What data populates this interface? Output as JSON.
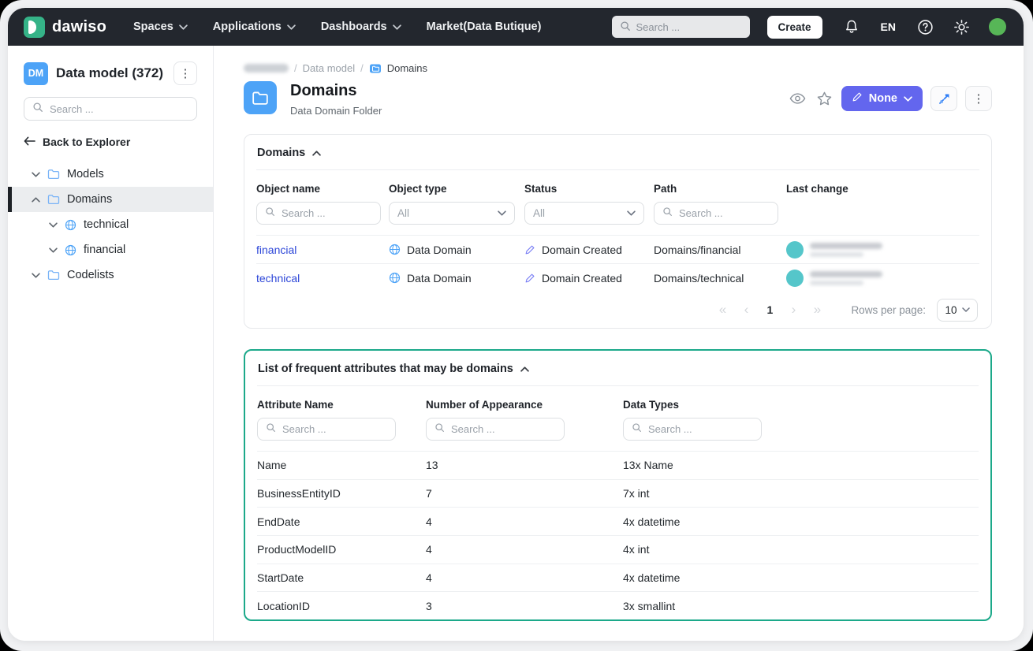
{
  "colors": {
    "navbar_bg": "#23272e",
    "brand_teal": "#35b388",
    "accent_blue": "#4da3f7",
    "link_blue": "#2c46d8",
    "none_button_purple": "#6366ee",
    "status_pencil_purple": "#7b80f5",
    "card2_border_green": "#1ca98a",
    "avatar_teal": "#55c6ca",
    "nav_avatar_green": "#57b657"
  },
  "navbar": {
    "logo": "dawiso",
    "menu": [
      {
        "label": "Spaces"
      },
      {
        "label": "Applications"
      },
      {
        "label": "Dashboards"
      },
      {
        "label": "Market(Data Butique)"
      }
    ],
    "search_placeholder": "Search ...",
    "create_label": "Create",
    "lang": "EN"
  },
  "sidebar": {
    "badge": "DM",
    "title": "Data model (372)",
    "search_placeholder": "Search ...",
    "back_label": "Back to Explorer",
    "tree": [
      {
        "label": "Models"
      },
      {
        "label": "Domains"
      },
      {
        "label": "technical"
      },
      {
        "label": "financial"
      },
      {
        "label": "Codelists"
      }
    ]
  },
  "breadcrumb": {
    "sep": "/",
    "item2": "Data model",
    "item3": "Domains"
  },
  "header": {
    "title": "Domains",
    "subtitle": "Data Domain Folder",
    "none_label": "None"
  },
  "card1": {
    "title": "Domains",
    "columns": [
      "Object name",
      "Object type",
      "Status",
      "Path",
      "Last change"
    ],
    "filters": {
      "object_name_placeholder": "Search ...",
      "object_type_value": "All",
      "status_value": "All",
      "path_placeholder": "Search ..."
    },
    "rows": [
      {
        "name": "financial",
        "type": "Data Domain",
        "status": "Domain Created",
        "path": "Domains/financial"
      },
      {
        "name": "technical",
        "type": "Data Domain",
        "status": "Domain Created",
        "path": "Domains/technical"
      }
    ],
    "pagination": {
      "first": "«",
      "prev": "‹",
      "page": "1",
      "next": "›",
      "last": "»",
      "rows_per_page_label": "Rows per page:",
      "rows_per_page_value": "10"
    }
  },
  "card2": {
    "title": "List of frequent attributes that may be domains",
    "columns": [
      "Attribute Name",
      "Number of Appearance",
      "Data Types"
    ],
    "search_placeholder": "Search ...",
    "rows": [
      [
        "Name",
        "13",
        "13x Name"
      ],
      [
        "BusinessEntityID",
        "7",
        "7x int"
      ],
      [
        "EndDate",
        "4",
        "4x datetime"
      ],
      [
        "ProductModelID",
        "4",
        "4x int"
      ],
      [
        "StartDate",
        "4",
        "4x datetime"
      ],
      [
        "LocationID",
        "3",
        "3x smallint"
      ]
    ]
  }
}
